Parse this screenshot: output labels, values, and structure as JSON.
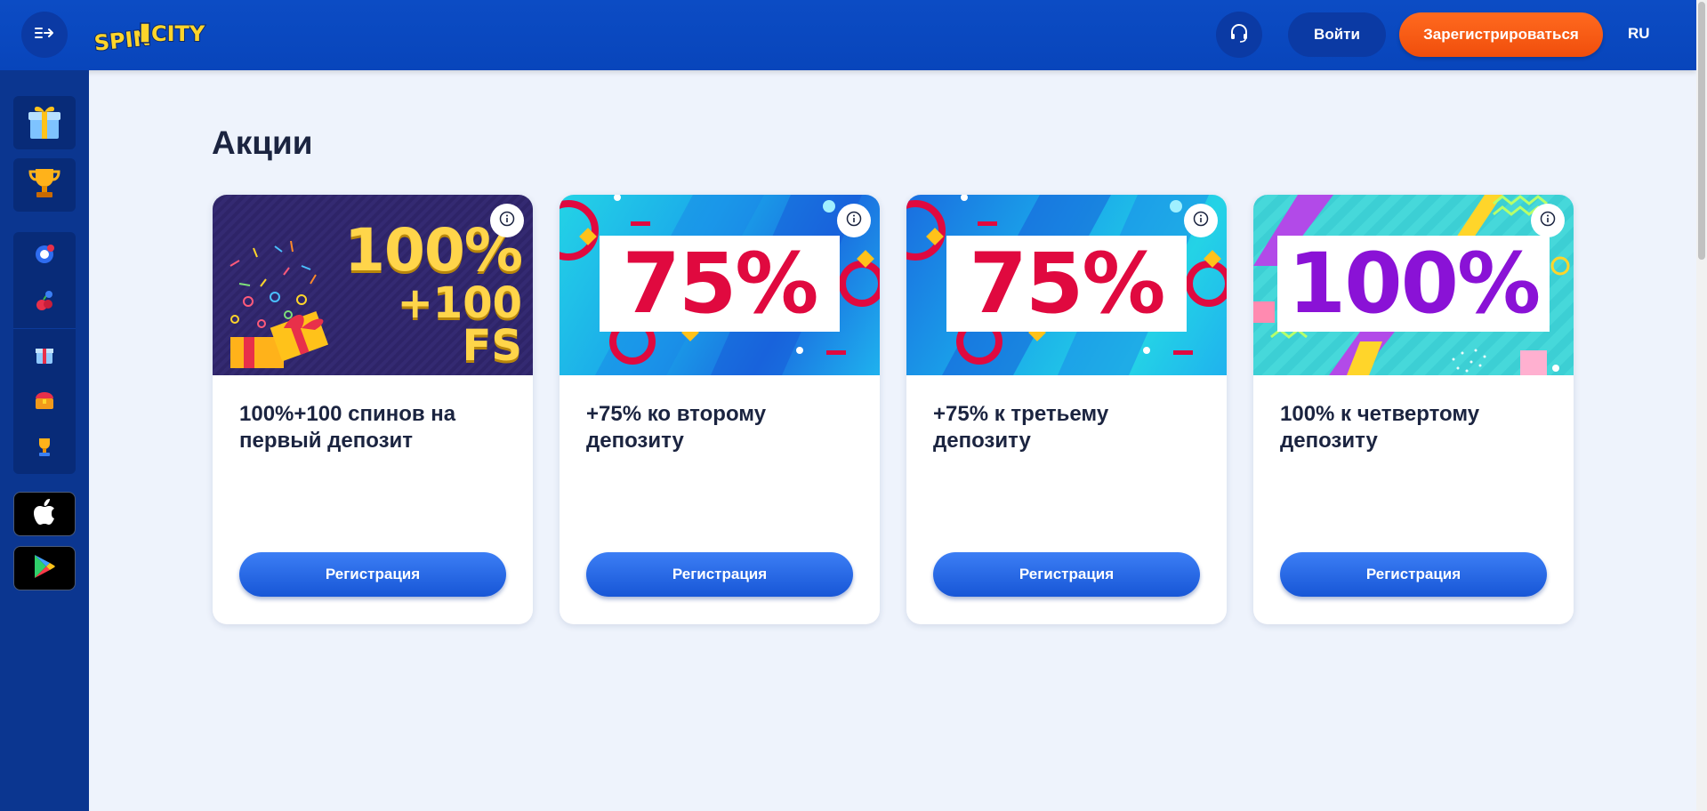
{
  "header": {
    "logo_text_1": "SPIN",
    "logo_text_2": "CITY",
    "menu_icon": "menu-arrow-icon",
    "support_icon": "headset-icon",
    "login_label": "Войти",
    "register_label": "Зарегистрироваться",
    "language": "RU"
  },
  "sidebar": {
    "top_items": [
      "gift-box-icon",
      "trophy-icon"
    ],
    "group_items": [
      "dice-icon",
      "fruit-slot-icon",
      "gift-icon",
      "treasure-chest-icon",
      "cup-icon"
    ],
    "apps": [
      "apple-icon",
      "google-play-icon"
    ]
  },
  "main": {
    "title": "Акции",
    "cards": [
      {
        "banner_line1": "100%",
        "banner_line2": "+100 FS",
        "title": "100%+100 спинов на первый депозит",
        "button": "Регистрация"
      },
      {
        "banner_percent": "75%",
        "title": "+75% ко второму депозиту",
        "button": "Регистрация"
      },
      {
        "banner_percent": "75%",
        "title": "+75% к третьему депозиту",
        "button": "Регистрация"
      },
      {
        "banner_percent": "100%",
        "title": "100% к четвертому депозиту",
        "button": "Регистрация"
      }
    ]
  },
  "colors": {
    "header_bg": "#0c4cc4",
    "sidebar_bg": "#0b3690",
    "register_accent": "#f04e0c",
    "button_blue": "#1756d6",
    "pct_red": "#e0093f",
    "pct_purple": "#8a12d6",
    "banner1_bg": "#2e2468"
  }
}
